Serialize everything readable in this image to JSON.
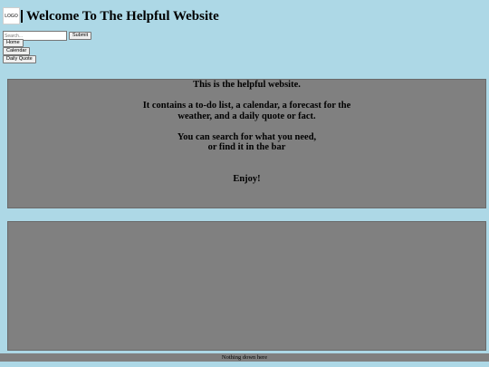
{
  "header": {
    "logo_text": "LOGO",
    "title": "Welcome To The Helpful Website"
  },
  "search": {
    "placeholder": "Search...",
    "value": "",
    "submit_label": "Submit"
  },
  "nav": {
    "items": [
      {
        "label": "Home"
      },
      {
        "label": "Calendar"
      },
      {
        "label": "Daily Quote"
      }
    ]
  },
  "intro": {
    "line1": "This is the helpful website.",
    "line2": "It contains a to-do list, a calendar, a forecast for the",
    "line3": "weather, and a daily quote or fact.",
    "line4": "You can search for what you need,",
    "line5": "or find it in the bar",
    "line6": "Enjoy!"
  },
  "footer": {
    "text": "Nothing down here"
  },
  "colors": {
    "background": "#add8e6",
    "panel": "#808080"
  }
}
